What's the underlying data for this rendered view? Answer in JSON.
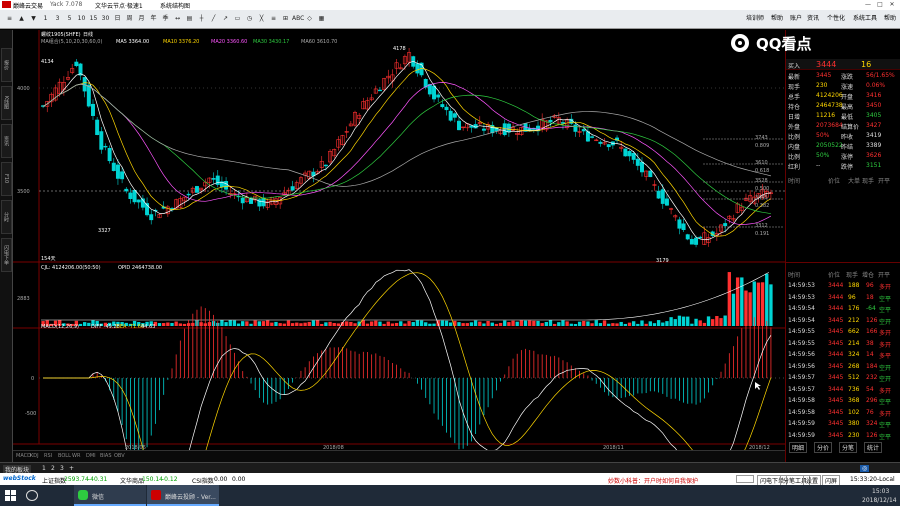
{
  "window": {
    "title": "巅峰云交易",
    "version": "Yack 7.078",
    "menu_items": [
      "文华云节点·极速1",
      "系统结构图"
    ]
  },
  "toolbar": {
    "right_menu": [
      "培训师",
      "帮助",
      "账户",
      "资讯",
      "个性化",
      "系统工具",
      "帮助"
    ],
    "left_tools": [
      "≡",
      "▲",
      "▼",
      "1",
      "3",
      "5",
      "10",
      "15",
      "30",
      "日",
      "周",
      "月",
      "年",
      "季",
      "↔",
      "▤",
      "┼",
      "╱",
      "↗",
      "▭",
      "◷",
      "╳",
      "≡",
      "⊞",
      "ABC",
      "◇",
      "▦"
    ]
  },
  "logo": {
    "text": "QQ看点"
  },
  "side_tabs": [
    "报价",
    "K线图",
    "资讯",
    "F10",
    "分时",
    "闪电下单"
  ],
  "chart": {
    "instrument_label": "螺纹1905(SHFE)",
    "period": "日线",
    "ma_line": {
      "MA5": "3364.00",
      "MA10": "3376.20",
      "MA20": "3360.60",
      "MA30": "3430.17",
      "MA60": "3610.70"
    },
    "price_ticks": [
      "4000",
      "3500"
    ],
    "date_labels": [
      "2018/06",
      "2018/08",
      "2018/11",
      "2018/12"
    ],
    "annotations": {
      "hi": "4178",
      "left_hi": "4134",
      "lo1": "3327",
      "lo2": "3179",
      "days": "154天",
      "ma_label": "MA组合(5,10,20,30,60,0)",
      "ma5": "MA5 3364.00",
      "ma10": "MA10 3376.20",
      "ma20": "MA20 3360.60",
      "ma30": "MA30 3430.17",
      "ma60": "MA60 3610.70"
    },
    "price_levels": [
      "3743",
      "0.809",
      "3610",
      "0.618",
      "3528",
      "0.500",
      "3445",
      "0.382",
      "3312",
      "0.191"
    ],
    "volume": {
      "label": "CJL: 4124206.00(50:50)",
      "opid": "OPID 2464738.00",
      "tick": "2883"
    },
    "macd": {
      "label": "MACD(12,26,9)",
      "diff": "DIFF -49.28",
      "dea": "DEA -71.60",
      "val": "44.63",
      "tick0": "0",
      "tick500": "-500"
    }
  },
  "quote": {
    "title": "QQ看点",
    "buy_label": "买入",
    "buy_price": "3444",
    "buy_vol": "16",
    "rows": [
      [
        "最新",
        "3445",
        "涨跌",
        "56/1.65%"
      ],
      [
        "现手",
        "230",
        "涨速",
        "0.06%"
      ],
      [
        "总手",
        "4124206",
        "开盘",
        "3416"
      ],
      [
        "持仓",
        "2464738",
        "最高",
        "3450"
      ],
      [
        "日增",
        "11216",
        "最低",
        "3405"
      ],
      [
        "外盘",
        "2073684",
        "结算价",
        "3427"
      ],
      [
        "比例",
        "50%",
        "昨收",
        "3419"
      ],
      [
        "内盘",
        "2050522",
        "昨结",
        "3389"
      ],
      [
        "比例",
        "50%",
        "涨停",
        "3626"
      ],
      [
        "红利",
        "--",
        "跌停",
        "3151"
      ]
    ],
    "tick_header": [
      "时间",
      "价位",
      "大单",
      "现手",
      "开平"
    ],
    "trade_header": [
      "时间",
      "价位",
      "现手",
      "增仓",
      "开平"
    ],
    "trades": [
      [
        "14:59:53",
        "3444",
        "188",
        "96",
        "多开"
      ],
      [
        "14:59:53",
        "3444",
        "96",
        "18",
        "空平"
      ],
      [
        "14:59:54",
        "3444",
        "176",
        "-64",
        "空平"
      ],
      [
        "14:59:54",
        "3445",
        "212",
        "126",
        "空开"
      ],
      [
        "14:59:55",
        "3445",
        "662",
        "166",
        "多开"
      ],
      [
        "14:59:55",
        "3445",
        "214",
        "38",
        "多开"
      ],
      [
        "14:59:56",
        "3444",
        "324",
        "14",
        "多平"
      ],
      [
        "14:59:56",
        "3445",
        "268",
        "184",
        "空开"
      ],
      [
        "14:59:57",
        "3445",
        "512",
        "232",
        "空开"
      ],
      [
        "14:59:57",
        "3444",
        "736",
        "54",
        "多开"
      ],
      [
        "14:59:58",
        "3445",
        "368",
        "296",
        "空平"
      ],
      [
        "14:59:58",
        "3445",
        "102",
        "76",
        "多开"
      ],
      [
        "14:59:59",
        "3445",
        "380",
        "324",
        "空平"
      ],
      [
        "14:59:59",
        "3445",
        "230",
        "126",
        "空平"
      ]
    ],
    "tabs": [
      "明细",
      "分价",
      "分笔",
      "统计"
    ]
  },
  "bottom_tabs": [
    "MACD",
    "KDJ",
    "RSI",
    "BOLL",
    "WR",
    "DMI",
    "BIAS",
    "OBV"
  ],
  "mode_tabs": [
    "我的板块",
    "1",
    "2",
    "3",
    "+"
  ],
  "status": {
    "brand": "webStock",
    "sh_label": "上证指数",
    "sh_val": "2593.74",
    "sh_chg": "-40.31",
    "wh_label": "文华商品",
    "wh_val": "150.14",
    "wh_chg": "-0.12",
    "cs_label": "CSI指数",
    "cs_val": "0.00",
    "cs_chg": "0.00",
    "msg": "妙数小科普：开户时如何自我保护",
    "buttons": [
      "闪电下单",
      "分笔工具",
      "设置",
      "闪屏"
    ],
    "time": "15:33:20-Local"
  },
  "taskbar": {
    "apps": [
      "微信",
      "巅峰云投顾 - Ver..."
    ],
    "clock": "15:03",
    "date": "2018/12/14"
  },
  "chart_data": {
    "type": "candlestick",
    "last": "3445",
    "high": "4178",
    "low": "3179"
  },
  "colors": {
    "up": "#ff3030",
    "down": "#00d4d4",
    "ma5": "#ffffff",
    "ma10": "#ffd700",
    "ma20": "#ff55ff",
    "ma30": "#2ecc40",
    "ma60": "#aaaaaa"
  }
}
